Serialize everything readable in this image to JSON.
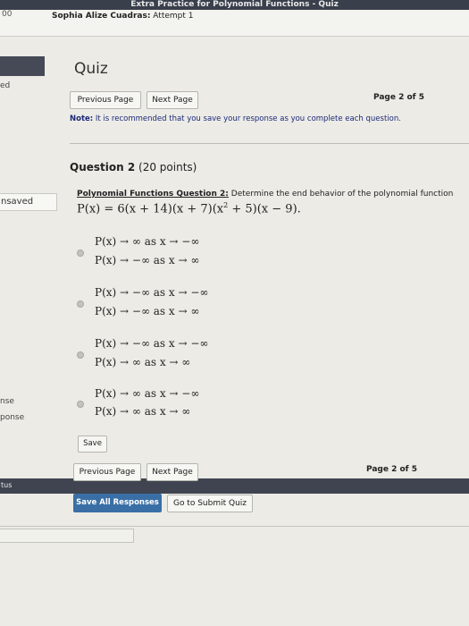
{
  "window": {
    "title": "Extra Practice for Polynomial Functions - Quiz"
  },
  "header": {
    "left_number": "00",
    "user_name": "Sophia Alize Cuadras:",
    "attempt": "Attempt 1"
  },
  "sidebar": {
    "fragment_1": "ed",
    "unsaved": "nsaved",
    "response_1": "nse",
    "response_2": "ponse",
    "status": "tus"
  },
  "quiz": {
    "title": "Quiz",
    "nav_top": {
      "previous": "Previous Page",
      "next": "Next Page",
      "page_indicator": "Page 2 of 5"
    },
    "note": {
      "label": "Note:",
      "text": "It is recommended that you save your response as you complete each question."
    },
    "question": {
      "number_label": "Question 2",
      "points": "(20 points)",
      "heading": "Polynomial Functions Question 2:",
      "prompt": "Determine the end behavior of the polynomial function",
      "formula_main": "P(x) = 6(x + 14)(x + 7)(x",
      "formula_exp": "2",
      "formula_tail": " + 5)(x − 9)."
    },
    "options": [
      {
        "line1": "P(x) → ∞ as x → −∞",
        "line2": "P(x) → −∞ as x → ∞"
      },
      {
        "line1": "P(x) → −∞ as x → −∞",
        "line2": "P(x) → −∞ as x → ∞"
      },
      {
        "line1": "P(x) → −∞ as x → −∞",
        "line2": "P(x) → ∞ as x → ∞"
      },
      {
        "line1": "P(x) → ∞ as x → −∞",
        "line2": "P(x) → ∞ as x → ∞"
      }
    ],
    "save_label": "Save",
    "nav_bottom": {
      "previous": "Previous Page",
      "next": "Next Page",
      "page_indicator": "Page 2 of 5"
    },
    "save_all_label": "Save All Responses",
    "submit_label": "Go to Submit Quiz"
  }
}
